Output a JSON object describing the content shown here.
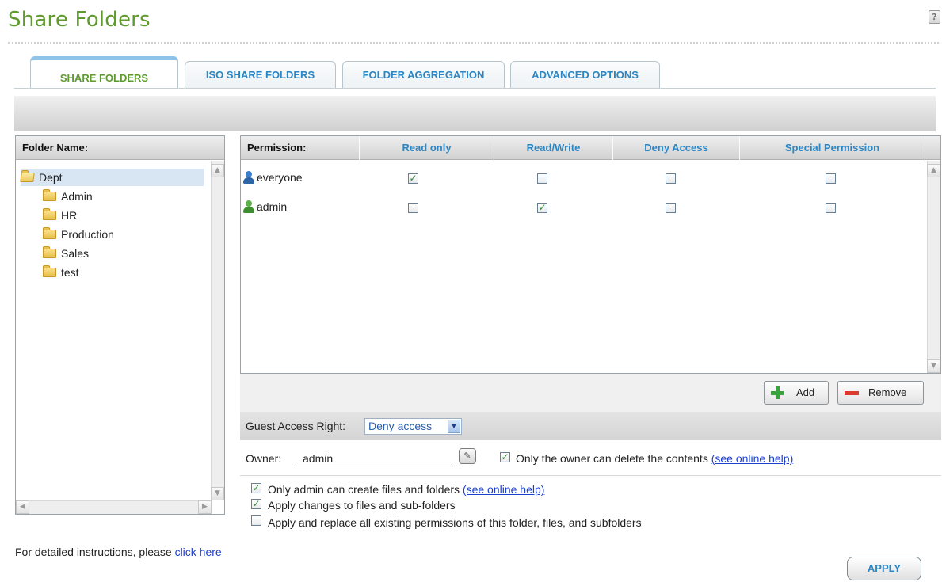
{
  "page": {
    "title": "Share Folders"
  },
  "tabs": [
    {
      "label": "SHARE FOLDERS",
      "active": true
    },
    {
      "label": "ISO SHARE FOLDERS",
      "active": false
    },
    {
      "label": "FOLDER AGGREGATION",
      "active": false
    },
    {
      "label": "ADVANCED OPTIONS",
      "active": false
    }
  ],
  "folders": {
    "header": "Folder Name:",
    "items": [
      {
        "name": "Dept",
        "level": 0,
        "selected": true,
        "open": true
      },
      {
        "name": "Admin",
        "level": 1
      },
      {
        "name": "HR",
        "level": 1
      },
      {
        "name": "Production",
        "level": 1
      },
      {
        "name": "Sales",
        "level": 1
      },
      {
        "name": "test",
        "level": 1
      }
    ]
  },
  "permissions": {
    "columns": [
      "Permission:",
      "Read only",
      "Read/Write",
      "Deny Access",
      "Special Permission"
    ],
    "rows": [
      {
        "user": "everyone",
        "icon": "group-icon",
        "read_only": true,
        "read_write": false,
        "deny": false,
        "special": false
      },
      {
        "user": "admin",
        "icon": "user-icon",
        "read_only": false,
        "read_write": true,
        "deny": false,
        "special": false
      }
    ],
    "add_label": "Add",
    "remove_label": "Remove"
  },
  "guest": {
    "label": "Guest Access Right:",
    "value": "Deny access"
  },
  "owner": {
    "label": "Owner:",
    "value": "admin",
    "only_owner_delete": {
      "checked": true,
      "label": "Only the owner can delete the contents",
      "link": "(see online help)"
    }
  },
  "options": [
    {
      "checked": true,
      "label": "Only admin can create files and folders",
      "link": "(see online help)"
    },
    {
      "checked": true,
      "label": "Apply changes to files and sub-folders",
      "link": ""
    },
    {
      "checked": false,
      "label": "Apply and replace all existing permissions of this folder, files, and subfolders",
      "link": ""
    }
  ],
  "footer": {
    "instructions_text": "For detailed instructions, please",
    "instructions_link": "click here",
    "apply_label": "APPLY"
  },
  "colors": {
    "title_green": "#5e9a2e",
    "tab_blue": "#2a86c4",
    "check_green": "#2f8a2f",
    "link_blue": "#1a3fd0"
  }
}
